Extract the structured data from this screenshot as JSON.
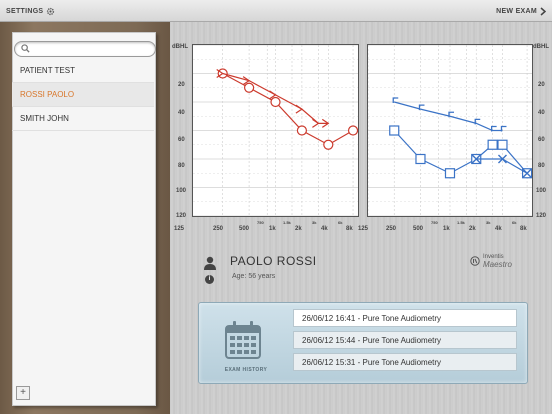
{
  "topbar": {
    "settings_label": "SETTINGS",
    "new_exam_label": "NEW EXAM"
  },
  "sidebar": {
    "search_placeholder": "",
    "patients": [
      {
        "name": "PATIENT TEST",
        "selected": false
      },
      {
        "name": "ROSSI PAOLO",
        "selected": true
      },
      {
        "name": "SMITH JOHN",
        "selected": false
      }
    ],
    "add_label": "+"
  },
  "chart_data": [
    {
      "type": "line",
      "ylabel": "dBHL",
      "ylim": [
        120,
        0
      ],
      "x": [
        "250",
        "500",
        "750",
        "1k",
        "1.5k",
        "2k",
        "3k",
        "4k",
        "8k"
      ],
      "series": [
        {
          "marker": "circle",
          "color": "#cc3b2e",
          "points": [
            [
              "250",
              20
            ],
            [
              "500",
              30
            ],
            [
              "1k",
              40
            ],
            [
              "2k",
              60
            ],
            [
              "4k",
              70
            ],
            [
              "8k",
              60
            ]
          ]
        },
        {
          "marker": "arrow-right",
          "color": "#cc3b2e",
          "points": [
            [
              "250",
              20
            ],
            [
              "500",
              25
            ],
            [
              "1k",
              35
            ],
            [
              "2k",
              45
            ],
            [
              "3k",
              55
            ],
            [
              "4k",
              55
            ]
          ]
        }
      ]
    },
    {
      "type": "line",
      "ylabel": "dBHL",
      "ylim": [
        120,
        0
      ],
      "x": [
        "125",
        "250",
        "500",
        "750",
        "1k",
        "1.5k",
        "2k",
        "3k",
        "4k",
        "8k"
      ],
      "series": [
        {
          "marker": "square",
          "color": "#3b73c6",
          "points": [
            [
              "250",
              60
            ],
            [
              "500",
              80
            ],
            [
              "1k",
              90
            ],
            [
              "2k",
              80
            ],
            [
              "3k",
              70
            ],
            [
              "4k",
              70
            ],
            [
              "8k",
              90
            ]
          ]
        },
        {
          "marker": "bracket",
          "color": "#3b73c6",
          "points": [
            [
              "250",
              40
            ],
            [
              "500",
              45
            ],
            [
              "1k",
              50
            ],
            [
              "2k",
              55
            ],
            [
              "3k",
              60
            ],
            [
              "4k",
              60
            ]
          ]
        },
        {
          "marker": "x",
          "color": "#3b73c6",
          "points": [
            [
              "2k",
              80
            ],
            [
              "4k",
              80
            ],
            [
              "8k",
              90
            ]
          ]
        }
      ]
    }
  ],
  "chart_axes": {
    "left_y_ticks": [
      "dBHL",
      "20",
      "40",
      "60",
      "80",
      "100",
      "120"
    ],
    "right_y_ticks": [
      "dBHL",
      "20",
      "40",
      "60",
      "80",
      "100",
      "120"
    ],
    "x_ticks_big": [
      "125",
      "250",
      "500",
      "1k",
      "2k",
      "4k",
      "8k"
    ],
    "x_ticks_small": [
      "750",
      "1.5k",
      "3k",
      "6k"
    ]
  },
  "patient": {
    "name": "PAOLO ROSSI",
    "age": "Age: 56 years"
  },
  "brand": {
    "line1": "Inventis",
    "line2": "Maestro"
  },
  "exam_history": {
    "label": "EXAM HISTORY",
    "items": [
      "26/06/12 16:41 - Pure Tone Audiometry",
      "26/06/12 15:44 - Pure Tone Audiometry",
      "26/06/12 15:31 - Pure Tone Audiometry"
    ]
  },
  "colors": {
    "right_ear": "#cc3b2e",
    "left_ear": "#3b73c6",
    "selected_patient": "#d8762a"
  }
}
